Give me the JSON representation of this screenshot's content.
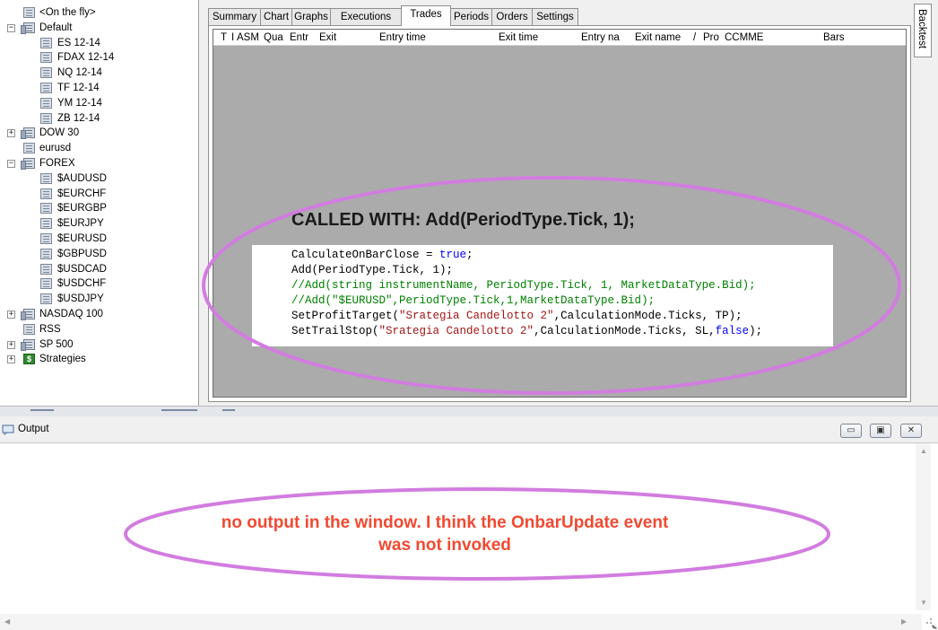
{
  "tree": {
    "items": [
      {
        "label": "<On the fly>",
        "level": 1,
        "icon": "sheet",
        "toggle": ""
      },
      {
        "label": "Default",
        "level": 0,
        "icon": "folder",
        "toggle": "−"
      },
      {
        "label": "ES 12-14",
        "level": 2,
        "icon": "sheet",
        "toggle": ""
      },
      {
        "label": "FDAX 12-14",
        "level": 2,
        "icon": "sheet",
        "toggle": ""
      },
      {
        "label": "NQ 12-14",
        "level": 2,
        "icon": "sheet",
        "toggle": ""
      },
      {
        "label": "TF 12-14",
        "level": 2,
        "icon": "sheet",
        "toggle": ""
      },
      {
        "label": "YM 12-14",
        "level": 2,
        "icon": "sheet",
        "toggle": ""
      },
      {
        "label": "ZB 12-14",
        "level": 2,
        "icon": "sheet",
        "toggle": ""
      },
      {
        "label": "DOW 30",
        "level": 0,
        "icon": "folder",
        "toggle": "+"
      },
      {
        "label": "eurusd",
        "level": 1,
        "icon": "sheet",
        "toggle": ""
      },
      {
        "label": "FOREX",
        "level": 0,
        "icon": "folder",
        "toggle": "−"
      },
      {
        "label": "$AUDUSD",
        "level": 2,
        "icon": "sheet",
        "toggle": ""
      },
      {
        "label": "$EURCHF",
        "level": 2,
        "icon": "sheet",
        "toggle": ""
      },
      {
        "label": "$EURGBP",
        "level": 2,
        "icon": "sheet",
        "toggle": ""
      },
      {
        "label": "$EURJPY",
        "level": 2,
        "icon": "sheet",
        "toggle": ""
      },
      {
        "label": "$EURUSD",
        "level": 2,
        "icon": "sheet",
        "toggle": ""
      },
      {
        "label": "$GBPUSD",
        "level": 2,
        "icon": "sheet",
        "toggle": ""
      },
      {
        "label": "$USDCAD",
        "level": 2,
        "icon": "sheet",
        "toggle": ""
      },
      {
        "label": "$USDCHF",
        "level": 2,
        "icon": "sheet",
        "toggle": ""
      },
      {
        "label": "$USDJPY",
        "level": 2,
        "icon": "sheet",
        "toggle": ""
      },
      {
        "label": "NASDAQ 100",
        "level": 0,
        "icon": "folder",
        "toggle": "+"
      },
      {
        "label": "RSS",
        "level": 1,
        "icon": "sheet",
        "toggle": ""
      },
      {
        "label": "SP 500",
        "level": 0,
        "icon": "folder",
        "toggle": "+"
      },
      {
        "label": "Strategies",
        "level": 0,
        "icon": "dollar",
        "toggle": "+"
      }
    ]
  },
  "tabs": [
    {
      "label": "Summary"
    },
    {
      "label": "Chart"
    },
    {
      "label": "Graphs"
    },
    {
      "label": "Executions"
    },
    {
      "label": "Trades",
      "active": true
    },
    {
      "label": "Periods"
    },
    {
      "label": "Orders"
    },
    {
      "label": "Settings"
    }
  ],
  "grid": {
    "columns": [
      "T",
      "I",
      "ASM",
      "Qua",
      "Entr",
      "Exit",
      "Entry time",
      "Exit time",
      "Entry na",
      "Exit name",
      "/",
      "Pro",
      "CCMME",
      "Bars"
    ]
  },
  "side_tab": {
    "label": "Backtest"
  },
  "annotation_code": {
    "title": "CALLED WITH: Add(PeriodType.Tick, 1);",
    "lines": [
      [
        {
          "t": "CalculateOnBarClose = ",
          "c": ""
        },
        {
          "t": "true",
          "c": "kw"
        },
        {
          "t": ";",
          "c": ""
        }
      ],
      [
        {
          "t": "Add(PeriodType.Tick, 1);",
          "c": ""
        }
      ],
      [
        {
          "t": "//Add(string instrumentName, PeriodType.Tick, 1, MarketDataType.Bid);",
          "c": "cm"
        }
      ],
      [
        {
          "t": "//Add(\"$EURUSD\",PeriodType.Tick,1,MarketDataType.Bid);",
          "c": "cm"
        }
      ],
      [
        {
          "t": "SetProfitTarget(",
          "c": ""
        },
        {
          "t": "\"Srategia Candelotto 2\"",
          "c": "st"
        },
        {
          "t": ",CalculationMode.Ticks, TP);",
          "c": ""
        }
      ],
      [
        {
          "t": "SetTrailStop(",
          "c": ""
        },
        {
          "t": "\"Srategia Candelotto 2\"",
          "c": "st"
        },
        {
          "t": ",CalculationMode.Ticks, SL,",
          "c": ""
        },
        {
          "t": "false",
          "c": "kw"
        },
        {
          "t": ");",
          "c": ""
        }
      ]
    ]
  },
  "output": {
    "title": "Output",
    "buttons": {
      "minimize": "▭",
      "restore": "▣",
      "close": "✕"
    }
  },
  "annotation_output": {
    "line1": "no output in the window. I think the OnbarUpdate  event",
    "line2": "was not invoked"
  },
  "colors": {
    "highlight_ring": "#d27ce0",
    "annotation_red": "#f04a32",
    "grid_bg": "#ababab"
  }
}
